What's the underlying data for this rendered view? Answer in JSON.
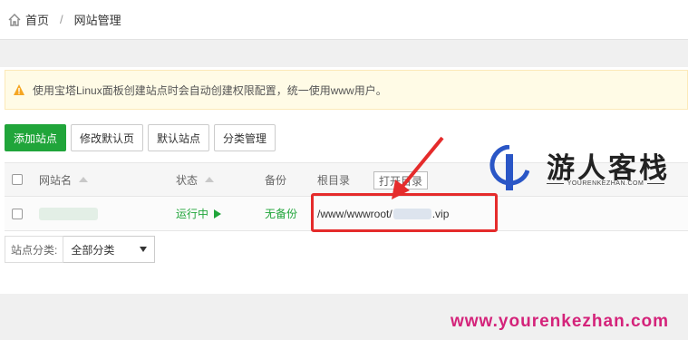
{
  "breadcrumb": {
    "home": "首页",
    "separator": "/",
    "current": "网站管理"
  },
  "notice": {
    "text": "使用宝塔Linux面板创建站点时会自动创建权限配置，统一使用www用户。"
  },
  "toolbar": {
    "add_site": "添加站点",
    "edit_default_page": "修改默认页",
    "default_site": "默认站点",
    "category_manage": "分类管理"
  },
  "table": {
    "headers": {
      "site_name": "网站名",
      "status": "状态",
      "backup": "备份",
      "root_dir": "根目录"
    },
    "rows": [
      {
        "status": "运行中",
        "backup": "无备份",
        "path_prefix": "/www/wwwroot/",
        "path_suffix": ".vip"
      }
    ]
  },
  "open_dir": "打开目录",
  "filter": {
    "label": "站点分类:",
    "selected": "全部分类"
  },
  "watermark": {
    "title": "游人客栈",
    "subtitle": "YOURENKEZHAN.COM",
    "url": "www.yourenkezhan.com"
  },
  "colors": {
    "primary": "#20a53a",
    "highlight": "#e52b2b",
    "watermark_url": "#d4237a"
  },
  "icons": {
    "home": "home-icon",
    "warning": "warning-icon",
    "sort": "sort-up-icon",
    "play": "play-icon",
    "dropdown": "chevron-down-icon"
  }
}
